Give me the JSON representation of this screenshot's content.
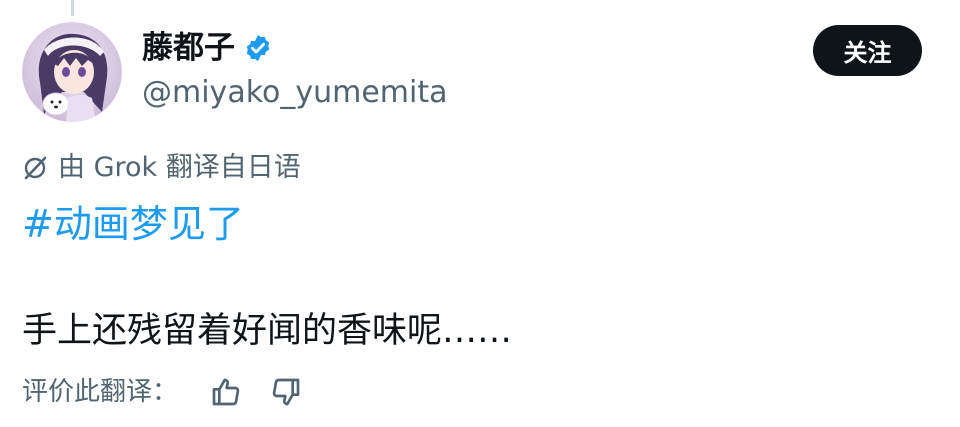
{
  "author": {
    "display_name": "藤都子",
    "handle": "@miyako_yumemita",
    "verified": true
  },
  "follow_button": {
    "label": "关注"
  },
  "translation": {
    "notice": "由 Grok 翻译自日语"
  },
  "tweet": {
    "hashtag": "#动画梦见了",
    "text": "手上还残留着好闻的香味呢……"
  },
  "rating": {
    "label": "评价此翻译："
  },
  "colors": {
    "accent": "#1d9bf0",
    "text_primary": "#0f1419",
    "text_secondary": "#536471",
    "button_bg": "#0f1419"
  }
}
